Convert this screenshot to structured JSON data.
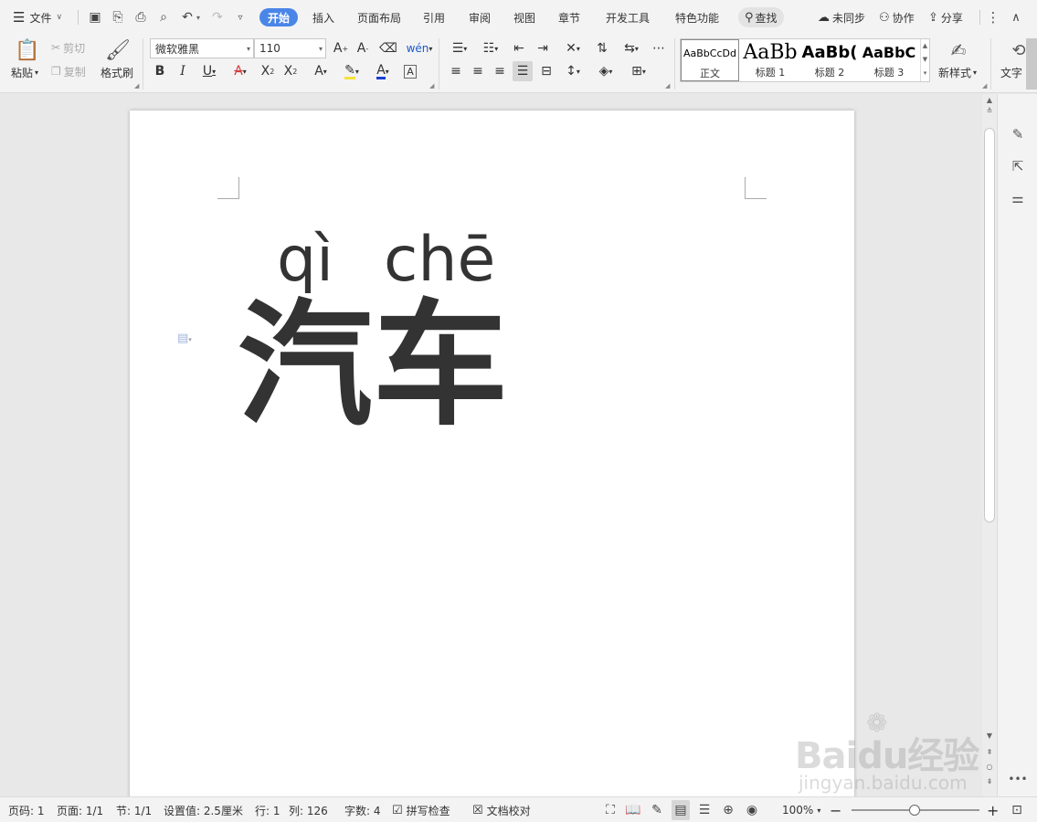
{
  "menu": {
    "file_label": "文件",
    "tabs": [
      "开始",
      "插入",
      "页面布局",
      "引用",
      "审阅",
      "视图",
      "章节",
      "开发工具",
      "特色功能"
    ],
    "search_label": "查找",
    "sync_label": "未同步",
    "collab_label": "协作",
    "share_label": "分享"
  },
  "ribbon": {
    "paste_label": "粘贴",
    "cut_label": "剪切",
    "copy_label": "复制",
    "format_painter_label": "格式刷",
    "font_name": "微软雅黑",
    "font_size": "110",
    "styles": [
      {
        "preview": "AaBbCcDd",
        "name": "正文"
      },
      {
        "preview": "AaBb",
        "name": "标题 1"
      },
      {
        "preview": "AaBb(",
        "name": "标题 2"
      },
      {
        "preview": "AaBbC",
        "name": "标题 3"
      }
    ],
    "new_style_label": "新样式",
    "text_tools_label": "文字"
  },
  "document": {
    "pinyin_1": "qì",
    "pinyin_2": "chē",
    "hanzi": "汽车"
  },
  "status": {
    "page_no": "页码: 1",
    "pages": "页面: 1/1",
    "section": "节: 1/1",
    "setting": "设置值: 2.5厘米",
    "row": "行: 1",
    "col": "列: 126",
    "word_count": "字数: 4",
    "spell_check": "拼写检查",
    "doc_review": "文档校对",
    "zoom": "100%"
  },
  "watermark": {
    "logo": "Baidu经验",
    "url": "jingyan.baidu.com"
  },
  "colors": {
    "accent": "#4a86e8",
    "highlight": "#f5e33a",
    "font_color": "#1a3fd1",
    "text_underline": "#d23c3c"
  }
}
